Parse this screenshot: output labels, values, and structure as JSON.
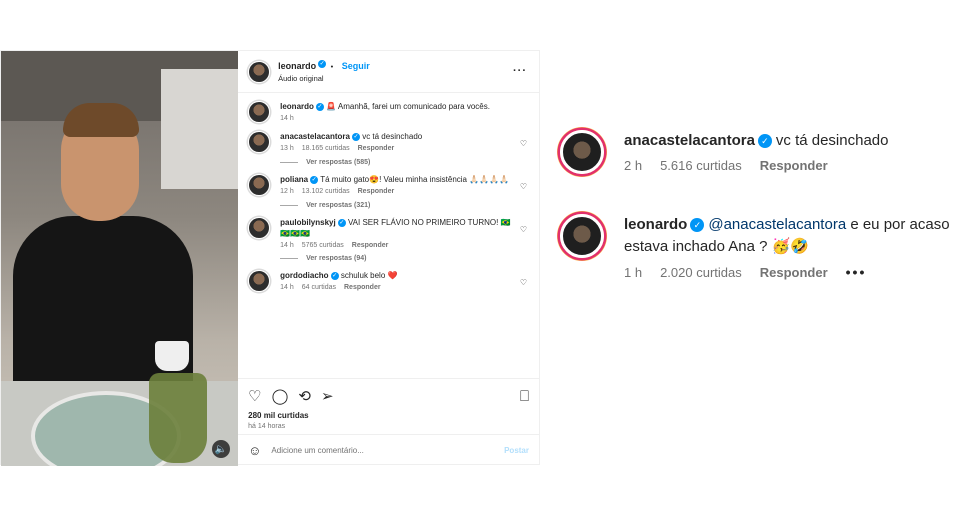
{
  "post": {
    "header": {
      "username": "leonardo",
      "follow_label": "Seguir",
      "dot": "•",
      "audio": "Áudio original"
    },
    "caption": {
      "username": "leonardo",
      "emoji": "🚨",
      "text": "Amanhã, farei um comunicado para vocês.",
      "time": "14 h"
    },
    "comments": [
      {
        "username": "anacastelacantora",
        "text": "vc tá desinchado",
        "time": "13 h",
        "likes": "18.165 curtidas",
        "reply": "Responder",
        "view_replies": "Ver respostas (585)"
      },
      {
        "username": "poliana",
        "text": "Tá muito gato😍! Valeu minha insistência 🙏🏻🙏🏻🙏🏻🙏🏻",
        "time": "12 h",
        "likes": "13.102 curtidas",
        "reply": "Responder",
        "view_replies": "Ver respostas (321)"
      },
      {
        "username": "paulobilynskyj",
        "text": "VAI SER FLÁVIO NO PRIMEIRO TURNO! 🇧🇷🇧🇷🇧🇷🇧🇷",
        "time": "14 h",
        "likes": "5765 curtidas",
        "reply": "Responder",
        "view_replies": "Ver respostas (94)"
      },
      {
        "username": "gordodiacho",
        "text": "schuluk belo ❤️",
        "time": "14 h",
        "likes": "64 curtidas",
        "reply": "Responder"
      }
    ],
    "likes_count": "280 mil curtidas",
    "posted_time": "há 14 horas",
    "add_comment_placeholder": "Adicione um comentário...",
    "post_button": "Postar"
  },
  "zoom": {
    "comment1": {
      "username": "anacastelacantora",
      "text": "vc tá desinchado",
      "time": "2 h",
      "likes": "5.616 curtidas",
      "reply": "Responder"
    },
    "comment2": {
      "username": "leonardo",
      "mention": "@anacastelacantora",
      "text": "e eu por acaso estava inchado Ana ? 🥳🤣",
      "time": "1 h",
      "likes": "2.020 curtidas",
      "reply": "Responder",
      "more": "•••"
    }
  }
}
